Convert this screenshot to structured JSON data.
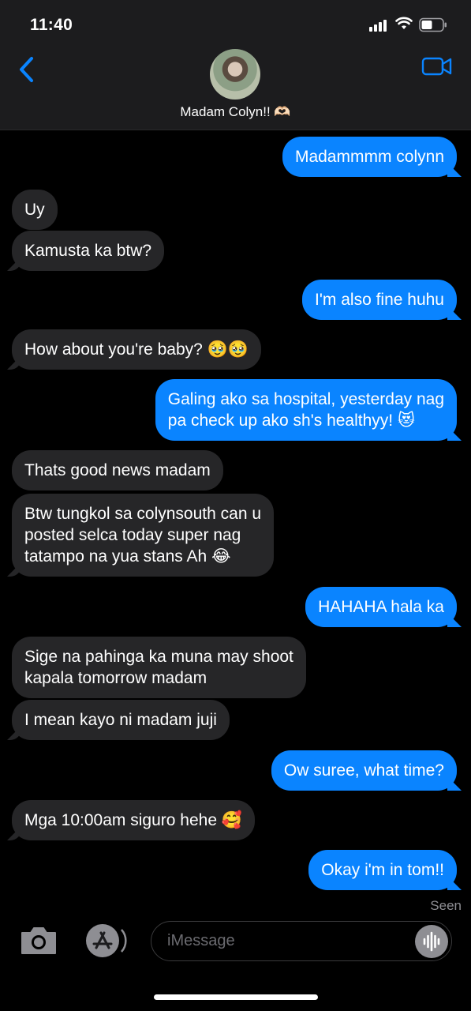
{
  "status_bar": {
    "time": "11:40"
  },
  "header": {
    "contact_name": "Madam Colyn!! 🫶🏻"
  },
  "messages": [
    {
      "dir": "out",
      "text": "Madammmm colynn"
    },
    {
      "dir": "in",
      "text": "Uy"
    },
    {
      "dir": "in",
      "text": "Kamusta ka btw?"
    },
    {
      "dir": "out",
      "text": "I'm also fine huhu"
    },
    {
      "dir": "in",
      "text": "How about you're baby? 🥹🥹"
    },
    {
      "dir": "out",
      "text": "Galing ako sa hospital, yesterday nag\npa check up ako sh's healthyy! 😻"
    },
    {
      "dir": "in",
      "text": "Thats good news madam"
    },
    {
      "dir": "in",
      "text": "Btw tungkol sa colynsouth can u\nposted selca today super nag\ntatampo na yua stans Ah 😂"
    },
    {
      "dir": "out",
      "text": "HAHAHA hala ka"
    },
    {
      "dir": "in",
      "text": "Sige na pahinga ka muna may shoot\nkapala tomorrow madam"
    },
    {
      "dir": "in",
      "text": "I mean kayo ni madam juji"
    },
    {
      "dir": "out",
      "text": "Ow suree, what time?"
    },
    {
      "dir": "in",
      "text": "Mga 10:00am siguro hehe 🥰"
    },
    {
      "dir": "out",
      "text": "Okay i'm in tom!!"
    }
  ],
  "seen_label": "Seen",
  "input": {
    "placeholder": "iMessage"
  },
  "icons": {
    "back": "chevron-left-icon",
    "facetime": "video-camera-icon",
    "camera": "camera-icon",
    "apps": "app-store-icon",
    "voice": "waveform-icon"
  },
  "colors": {
    "outgoing": "#0a84ff",
    "incoming": "#262628",
    "accent": "#0a84ff"
  }
}
